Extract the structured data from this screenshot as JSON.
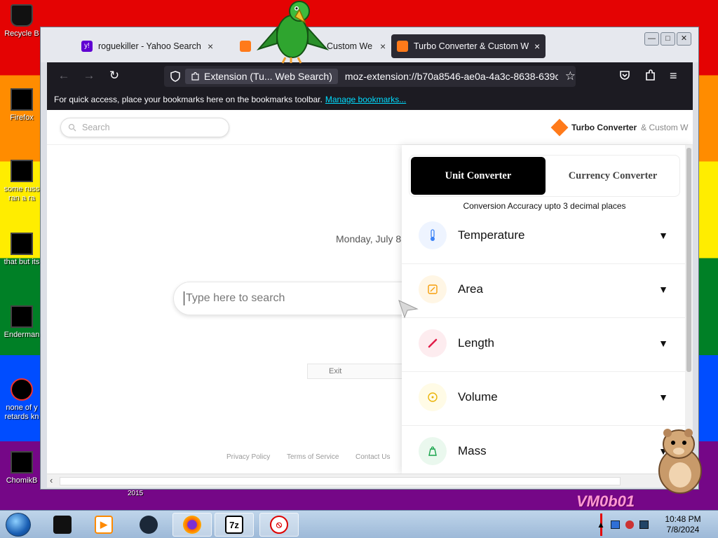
{
  "desktop": {
    "icons": [
      {
        "label": "Recycle B"
      },
      {
        "label": "Firefox"
      },
      {
        "label": "some russ ran a ra"
      },
      {
        "label": "that but its"
      },
      {
        "label": "Enderman"
      },
      {
        "label": "none of y retards kn"
      },
      {
        "label": "ChomikB"
      }
    ],
    "wallpaper_texts": [
      "2015",
      "VM0b01"
    ]
  },
  "browser": {
    "tabs": [
      {
        "title": "roguekiller - Yahoo Search Resu",
        "close": "×"
      },
      {
        "title": "Custom We",
        "close": "×"
      },
      {
        "title": "Turbo Converter & Custom We",
        "close": "×"
      }
    ],
    "window_controls": {
      "minimize": "—",
      "maximize": "□",
      "close": "✕"
    },
    "nav": {
      "back": "←",
      "forward": "→",
      "reload": "↻"
    },
    "identity_label": "Extension (Tu... Web Search)",
    "url": "moz-extension://b70a8546-ae0a-4a3c-8638-639c",
    "bookmarks_bar": {
      "text": "For quick access, place your bookmarks here on the bookmarks toolbar.",
      "link": "Manage bookmarks..."
    }
  },
  "page": {
    "top_search_placeholder": "Search",
    "logo_text": "Turbo Converter",
    "logo_suffix": "& Custom W",
    "date": "Monday, July 8",
    "main_search_placeholder": "Type here to search",
    "exit_label": "Exit",
    "footer_links": [
      "Privacy Policy",
      "Terms of Service",
      "Contact Us"
    ]
  },
  "converter": {
    "tabs": [
      "Unit Converter",
      "Currency Converter"
    ],
    "selected_tab": "Unit Converter",
    "accuracy_note": "Conversion Accuracy upto 3 decimal places",
    "categories": [
      {
        "label": "Temperature",
        "icon": "thermometer-icon",
        "color": "#3b82f6",
        "bg": "#eef4ff"
      },
      {
        "label": "Area",
        "icon": "area-icon",
        "color": "#f59e0b",
        "bg": "#fff6e5"
      },
      {
        "label": "Length",
        "icon": "ruler-icon",
        "color": "#e11d48",
        "bg": "#fdecef"
      },
      {
        "label": "Volume",
        "icon": "volume-icon",
        "color": "#eab308",
        "bg": "#fffbe6"
      },
      {
        "label": "Mass",
        "icon": "weight-icon",
        "color": "#16a34a",
        "bg": "#eaf8ee"
      }
    ]
  },
  "taskbar": {
    "clock_time": "10:48 PM",
    "clock_date": "7/8/2024",
    "items": [
      "terminal",
      "media-player",
      "steam",
      "firefox",
      "7z",
      "blocked-app"
    ],
    "zip_label": "7z"
  }
}
